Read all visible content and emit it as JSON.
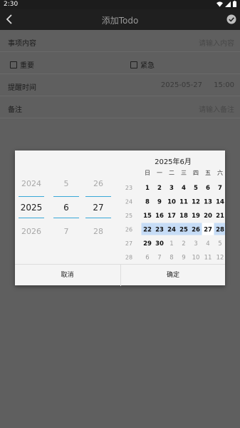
{
  "status": {
    "time": "2:30"
  },
  "appbar": {
    "title": "添加Todo"
  },
  "form": {
    "content_label": "事项内容",
    "content_placeholder": "请输入内容",
    "important_label": "重要",
    "urgent_label": "紧急",
    "remind_label": "提醒时间",
    "remind_date": "2025-05-27",
    "remind_time": "15:00",
    "note_label": "备注",
    "note_placeholder": "请输入备注"
  },
  "picker": {
    "year": {
      "prev": "2024",
      "cur": "2025",
      "next": "2026"
    },
    "month": {
      "prev": "5",
      "cur": "6",
      "next": "7"
    },
    "day": {
      "prev": "26",
      "cur": "27",
      "next": "28"
    }
  },
  "calendar": {
    "title": "2025年6月",
    "weekdays": [
      "日",
      "一",
      "二",
      "三",
      "四",
      "五",
      "六"
    ],
    "weeks": [
      {
        "num": "23",
        "days": [
          "1",
          "2",
          "3",
          "4",
          "5",
          "6",
          "7"
        ],
        "out": [
          false,
          false,
          false,
          false,
          false,
          false,
          false
        ]
      },
      {
        "num": "24",
        "days": [
          "8",
          "9",
          "10",
          "11",
          "12",
          "13",
          "14"
        ],
        "out": [
          false,
          false,
          false,
          false,
          false,
          false,
          false
        ]
      },
      {
        "num": "25",
        "days": [
          "15",
          "16",
          "17",
          "18",
          "19",
          "20",
          "21"
        ],
        "out": [
          false,
          false,
          false,
          false,
          false,
          false,
          false
        ]
      },
      {
        "num": "26",
        "days": [
          "22",
          "23",
          "24",
          "25",
          "26",
          "27",
          "28"
        ],
        "out": [
          false,
          false,
          false,
          false,
          false,
          false,
          false
        ]
      },
      {
        "num": "27",
        "days": [
          "29",
          "30",
          "1",
          "2",
          "3",
          "4",
          "5"
        ],
        "out": [
          false,
          false,
          true,
          true,
          true,
          true,
          true
        ]
      },
      {
        "num": "28",
        "days": [
          "6",
          "7",
          "8",
          "9",
          "10",
          "11",
          "12"
        ],
        "out": [
          true,
          true,
          true,
          true,
          true,
          true,
          true
        ]
      }
    ],
    "selected_day": "27",
    "highlight_week": "26"
  },
  "buttons": {
    "cancel": "取消",
    "ok": "确定"
  },
  "colors": {
    "highlight": "#c6dcf6",
    "accent": "#39a8d8"
  }
}
